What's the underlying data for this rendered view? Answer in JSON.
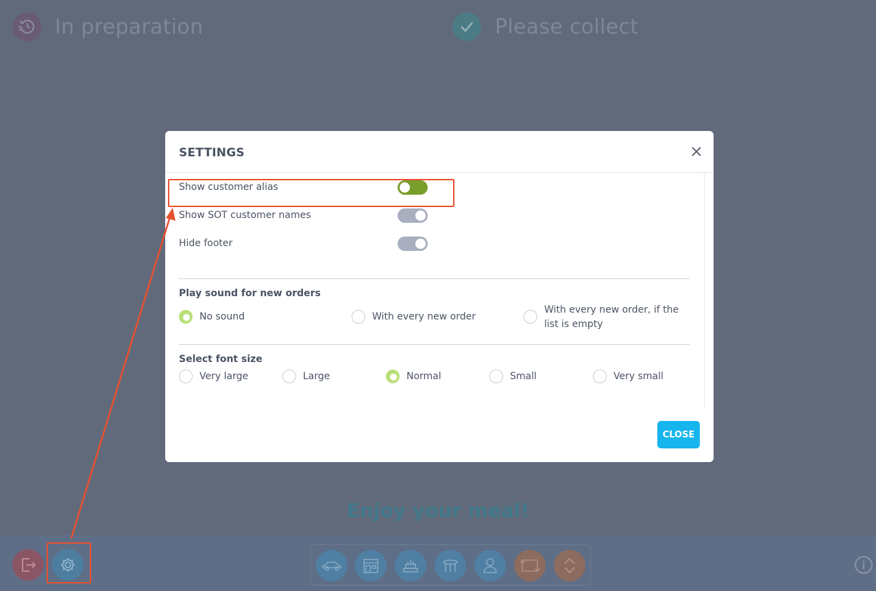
{
  "background": {
    "columns": [
      {
        "title": "In preparation",
        "icon": "history-clock-icon"
      },
      {
        "title": "Please collect",
        "icon": "checkmark-icon"
      }
    ],
    "footer_message": "Enjoy your meal!"
  },
  "footer": {
    "left_buttons": [
      "logout-icon",
      "settings-gear-icon"
    ],
    "toolbar_buttons": [
      "car-icon",
      "store-icon",
      "food-tray-icon",
      "table-icon",
      "user-icon",
      "swap-icon",
      "chevrons-icon"
    ],
    "info_icon": "info-icon"
  },
  "settings": {
    "title": "SETTINGS",
    "toggles": [
      {
        "label": "Show customer alias",
        "on": true
      },
      {
        "label": "Show SOT customer names",
        "on": false
      },
      {
        "label": "Hide footer",
        "on": false
      }
    ],
    "sound": {
      "title": "Play sound for new orders",
      "options": [
        "No sound",
        "With every new order",
        "With every new order, if the list is empty"
      ],
      "selected": "No sound"
    },
    "font_size": {
      "title": "Select font size",
      "options": [
        "Very large",
        "Large",
        "Normal",
        "Small",
        "Very small"
      ],
      "selected": "Normal"
    },
    "close_label": "CLOSE"
  },
  "colors": {
    "overlay": "#616a7b",
    "toggle_on": "#7a9e2c",
    "radio_checked": "#b9e07a",
    "close_button": "#16b5ee",
    "annotation": "#e9502f"
  }
}
